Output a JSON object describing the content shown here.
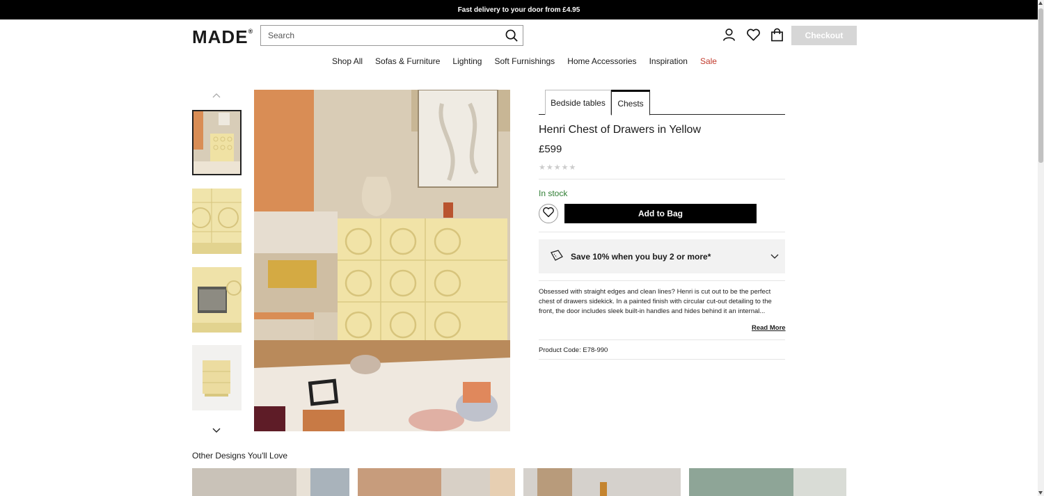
{
  "announcement": "Fast delivery to your door from £4.95",
  "header": {
    "logo": "MADE",
    "logo_mark": "®",
    "search_placeholder": "Search",
    "checkout_label": "Checkout"
  },
  "nav": {
    "items": [
      "Shop All",
      "Sofas & Furniture",
      "Lighting",
      "Soft Furnishings",
      "Home Accessories",
      "Inspiration",
      "Sale"
    ]
  },
  "product": {
    "tabs": [
      "Bedside tables",
      "Chests"
    ],
    "active_tab": "Chests",
    "title": "Henri Chest of Drawers in Yellow",
    "price": "£599",
    "rating_stars": 0,
    "stock": "In stock",
    "add_to_bag": "Add to Bag",
    "promo": "Save 10% when you buy 2 or more*",
    "description": "Obsessed with straight edges and clean lines? Henri is cut out to be the perfect chest of drawers sidekick. In a painted finish with circular cut-out detailing to the front, the door includes sleek built-in handles and hides behind it an internal...",
    "read_more": "Read More",
    "product_code_label": "Product Code: ",
    "product_code": "E78-990"
  },
  "recommendations": {
    "heading": "Other Designs You'll Love"
  },
  "colors": {
    "accent_sale": "#c0392b",
    "stock_green": "#2e7d32",
    "product_yellow": "#f0e2a4",
    "wall_orange": "#d98d55"
  }
}
